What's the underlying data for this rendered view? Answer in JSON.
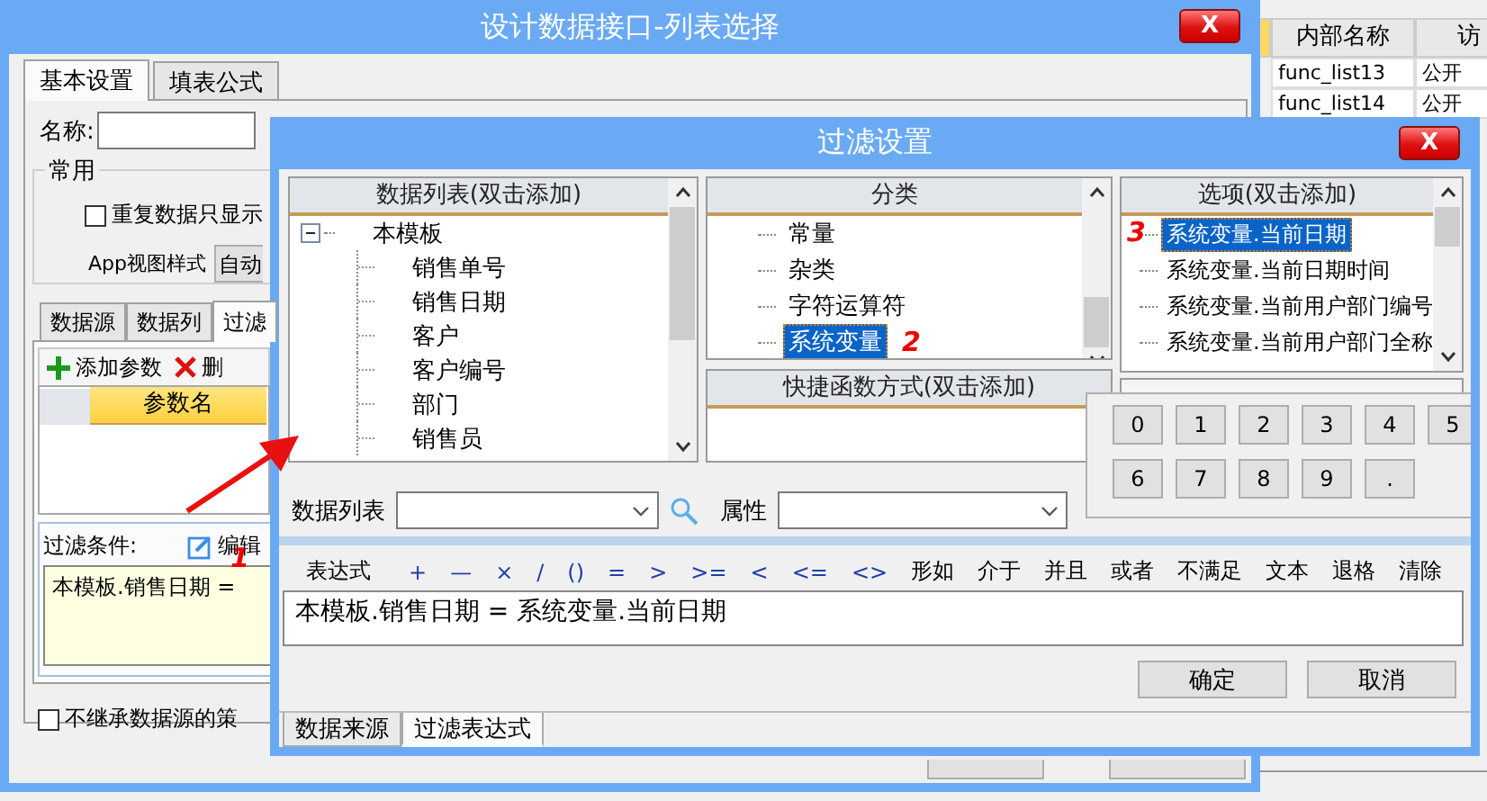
{
  "back_window": {
    "grid": {
      "columns": [
        "内部名称",
        "访"
      ],
      "rows": [
        [
          "func_list13",
          "公开"
        ],
        [
          "func_list14",
          "公开"
        ]
      ]
    }
  },
  "main_window": {
    "title": "设计数据接口-列表选择",
    "close": "X",
    "tabs": [
      {
        "label": "基本设置",
        "selected": true
      },
      {
        "label": "填表公式",
        "selected": false
      }
    ],
    "name_label": "名称:",
    "group_title": "常用",
    "dedupe_checkbox": {
      "label": "重复数据只显示",
      "checked": false
    },
    "app_view_label": "App视图样式",
    "app_view_value": "自动",
    "inner_tabs": [
      {
        "label": "数据源",
        "selected": false
      },
      {
        "label": "数据列",
        "selected": false
      },
      {
        "label": "过滤",
        "selected": true
      }
    ],
    "toolbar": [
      {
        "kind": "add",
        "label": "添加参数"
      },
      {
        "kind": "delete",
        "label": "删"
      }
    ],
    "param_table": {
      "columns": [
        "参数名"
      ]
    },
    "filter_label": "过滤条件:",
    "edit_button": "编辑",
    "edit_marker": "1",
    "filter_value": "本模板.销售日期 =",
    "inherit_checkbox": {
      "label": "不继承数据源的策",
      "checked": false
    }
  },
  "dialog": {
    "title": "过滤设置",
    "close": "X",
    "data_list": {
      "header": "数据列表(双击添加)",
      "tree": [
        {
          "label": "本模板",
          "expanded": true,
          "children": [
            {
              "label": "销售单号"
            },
            {
              "label": "销售日期"
            },
            {
              "label": "客户"
            },
            {
              "label": "客户编号"
            },
            {
              "label": "部门"
            },
            {
              "label": "销售员"
            }
          ]
        }
      ]
    },
    "category": {
      "header": "分类",
      "items": [
        {
          "label": "常量",
          "selected": false
        },
        {
          "label": "杂类",
          "selected": false
        },
        {
          "label": "字符运算符",
          "selected": false
        },
        {
          "label": "系统变量",
          "selected": true,
          "marker": "2"
        }
      ]
    },
    "quick_functions": {
      "header": "快捷函数方式(双击添加)"
    },
    "options": {
      "header": "选项(双击添加)",
      "items": [
        {
          "label": "系统变量.当前日期",
          "selected": true,
          "marker": "3"
        },
        {
          "label": "系统变量.当前日期时间",
          "selected": false
        },
        {
          "label": "系统变量.当前用户部门编号",
          "selected": false
        },
        {
          "label": "系统变量.当前用户部门全称",
          "selected": false
        }
      ]
    },
    "keypad": [
      [
        "0",
        "1",
        "2",
        "3",
        "4",
        "5"
      ],
      [
        "6",
        "7",
        "8",
        "9",
        "."
      ]
    ],
    "data_list_label": "数据列表",
    "property_label": "属性",
    "operators": [
      "表达式",
      "+",
      "—",
      "×",
      "/",
      "()",
      "=",
      ">",
      ">=",
      "<",
      "<=",
      "<>",
      "形如",
      "介于",
      "并且",
      "或者",
      "不满足",
      "文本",
      "退格",
      "清除"
    ],
    "expression": "本模板.销售日期 = 系统变量.当前日期",
    "buttons": [
      "确定",
      "取消"
    ],
    "bottom_tabs": [
      {
        "label": "数据来源",
        "selected": false
      },
      {
        "label": "过滤表达式",
        "selected": true
      }
    ]
  }
}
